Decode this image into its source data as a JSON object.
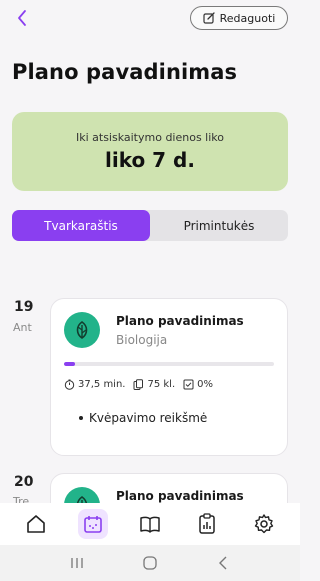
{
  "header": {
    "edit_label": "Redaguoti",
    "title": "Plano pavadinimas"
  },
  "countdown": {
    "label": "Iki atsiskaitymo dienos liko",
    "value": "liko 7 d.",
    "color": "#cfe3b0"
  },
  "tabs": [
    {
      "label": "Tvarkaraštis",
      "active": true
    },
    {
      "label": "Primintukės",
      "active": false
    }
  ],
  "entries": [
    {
      "day": "19",
      "weekday": "Ant",
      "title": "Plano pavadinimas",
      "subject": "Biologija",
      "icon": "leaf-icon",
      "progress": 0.05,
      "duration": "37,5 min.",
      "questions": "75 kl.",
      "percent": "0%",
      "topic": "Kvėpavimo reikšmė"
    },
    {
      "day": "20",
      "weekday": "Tre",
      "title": "Plano pavadinimas",
      "icon": "leaf-icon"
    }
  ],
  "nav": {
    "items": [
      "home-icon",
      "calendar-icon",
      "book-icon",
      "stats-icon",
      "settings-icon"
    ],
    "active": "calendar-icon"
  },
  "colors": {
    "accent": "#8a3ff0",
    "icon_bg": "#22b38a",
    "background": "#f6f5f7"
  }
}
